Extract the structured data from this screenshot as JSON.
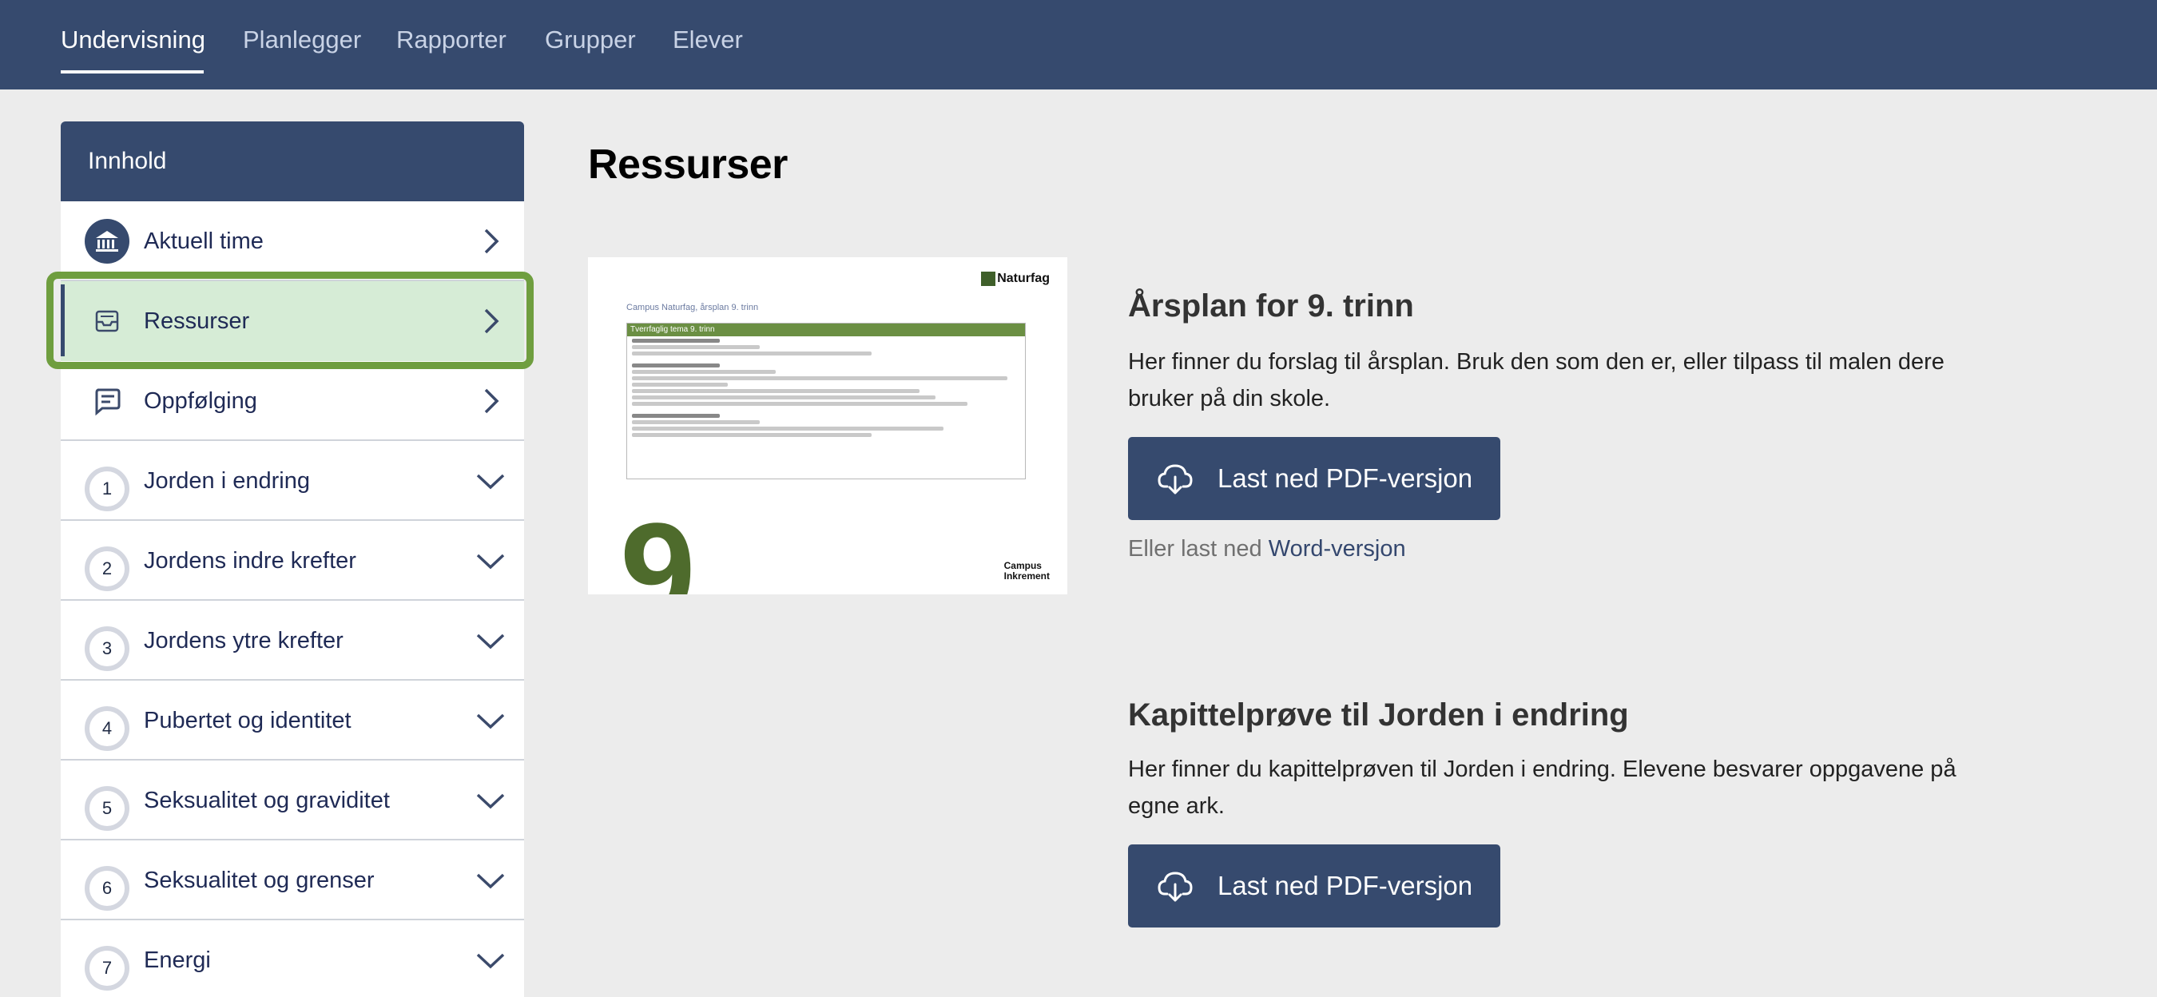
{
  "nav": {
    "tabs": [
      {
        "label": "Undervisning",
        "active": true
      },
      {
        "label": "Planlegger"
      },
      {
        "label": "Rapporter"
      },
      {
        "label": "Grupper"
      },
      {
        "label": "Elever"
      }
    ]
  },
  "sidebar": {
    "title": "Innhold",
    "items": [
      {
        "label": "Aktuell time",
        "icon": "bank-icon",
        "chevron": "right"
      },
      {
        "label": "Ressurser",
        "icon": "inbox-tray-icon",
        "chevron": "right",
        "selected": true
      },
      {
        "label": "Oppfølging",
        "icon": "chat-icon",
        "chevron": "right"
      },
      {
        "number": "1",
        "label": "Jorden i endring",
        "chevron": "down"
      },
      {
        "number": "2",
        "label": "Jordens indre krefter",
        "chevron": "down"
      },
      {
        "number": "3",
        "label": "Jordens ytre krefter",
        "chevron": "down"
      },
      {
        "number": "4",
        "label": "Pubertet og identitet",
        "chevron": "down"
      },
      {
        "number": "5",
        "label": "Seksualitet og graviditet",
        "chevron": "down"
      },
      {
        "number": "6",
        "label": "Seksualitet og grenser",
        "chevron": "down"
      },
      {
        "number": "7",
        "label": "Energi",
        "chevron": "down"
      }
    ]
  },
  "main": {
    "title": "Ressurser",
    "thumbnail": {
      "logo": "Naturfag",
      "subtitle": "Campus Naturfag, årsplan 9. trinn",
      "table_header": "Tverrfaglig tema 9. trinn",
      "big_number": "9",
      "brand_line1": "Campus",
      "brand_line2": "Inkrement"
    },
    "sections": [
      {
        "title": "Årsplan for 9. trinn",
        "text": "Her finner du forslag til årsplan. Bruk den som den er, eller tilpass til malen dere bruker på din skole.",
        "button": "Last ned PDF-versjon",
        "alt_prefix": "Eller last ned",
        "alt_link": "Word-versjon"
      },
      {
        "title": "Kapittelprøve til Jorden i endring",
        "text": "Her finner du kapittelprøven til Jorden i endring. Elevene besvarer oppgavene på egne ark.",
        "button": "Last ned PDF-versjon"
      }
    ]
  },
  "colors": {
    "primary": "#364a6e",
    "selected_bg": "#d6ecd6",
    "highlight": "#6f9e3f",
    "page_bg": "#ececec"
  }
}
